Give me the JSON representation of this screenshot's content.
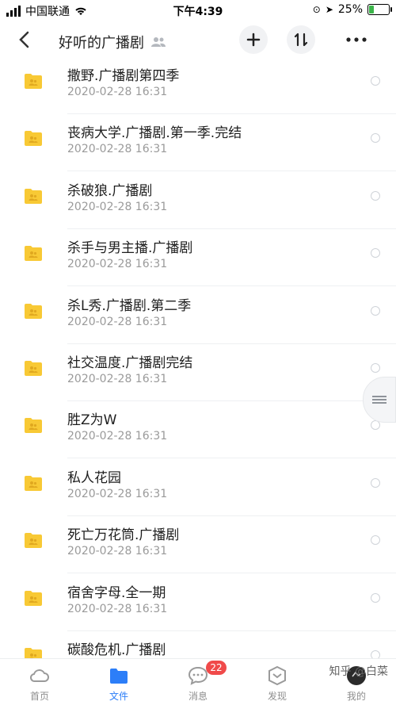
{
  "status_bar": {
    "carrier": "中国联通",
    "time": "下午4:39",
    "battery": "25%",
    "battery_level": 0.25
  },
  "header": {
    "title": "好听的广播剧",
    "buttons": [
      "add",
      "sort",
      "more"
    ]
  },
  "files": [
    {
      "name": "撒野.广播剧第四季",
      "date": "2020-02-28 16:31"
    },
    {
      "name": "丧病大学.广播剧.第一季.完结",
      "date": "2020-02-28 16:31"
    },
    {
      "name": "杀破狼.广播剧",
      "date": "2020-02-28 16:31"
    },
    {
      "name": "杀手与男主播.广播剧",
      "date": "2020-02-28 16:31"
    },
    {
      "name": "杀L秀.广播剧.第二季",
      "date": "2020-02-28 16:31"
    },
    {
      "name": "社交温度.广播剧完结",
      "date": "2020-02-28 16:31"
    },
    {
      "name": "胜Z为W",
      "date": "2020-02-28 16:31"
    },
    {
      "name": "私人花园",
      "date": "2020-02-28 16:31"
    },
    {
      "name": "死亡万花筒.广播剧",
      "date": "2020-02-28 16:31"
    },
    {
      "name": "宿舍字母.全一期",
      "date": "2020-02-28 16:31"
    },
    {
      "name": "碳酸危机.广播剧",
      "date": ""
    }
  ],
  "tabbar": {
    "tabs": [
      {
        "label": "首页",
        "icon": "cloud-icon"
      },
      {
        "label": "文件",
        "icon": "folder-icon"
      },
      {
        "label": "消息",
        "icon": "chat-icon",
        "badge": "22"
      },
      {
        "label": "发现",
        "icon": "discover-icon"
      },
      {
        "label": "我的",
        "icon": "avatar"
      }
    ],
    "active": 1
  },
  "watermark": "知乎 @白菜",
  "colors": {
    "accent": "#2c7ef8",
    "folder": "#f8c935",
    "badge": "#f04a4a"
  }
}
